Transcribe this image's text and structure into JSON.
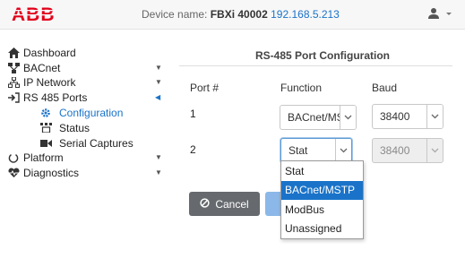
{
  "header": {
    "logo_text": "ABB",
    "device_label": "Device name:",
    "device_name": "FBXi 40002",
    "device_ip": "192.168.5.213",
    "brand_color": "#e2001a"
  },
  "sidebar": {
    "items": [
      {
        "label": "Dashboard",
        "icon": "home-icon"
      },
      {
        "label": "BACnet",
        "icon": "network-icon"
      },
      {
        "label": "IP Network",
        "icon": "sitemap-icon"
      },
      {
        "label": "RS 485 Ports",
        "icon": "sign-in-icon"
      },
      {
        "label": "Configuration",
        "icon": "gear-icon"
      },
      {
        "label": "Status",
        "icon": "status-icon"
      },
      {
        "label": "Serial Captures",
        "icon": "video-icon"
      },
      {
        "label": "Platform",
        "icon": "power-icon"
      },
      {
        "label": "Diagnostics",
        "icon": "heartbeat-icon"
      }
    ]
  },
  "panel": {
    "title": "RS-485 Port Configuration",
    "col_port": "Port #",
    "col_function": "Function",
    "col_baud": "Baud",
    "rows": [
      {
        "port": "1",
        "function": "BACnet/MSTP",
        "baud": "38400"
      },
      {
        "port": "2",
        "function": "Stat",
        "baud": "38400"
      }
    ],
    "dropdown_options": [
      "Stat",
      "BACnet/MSTP",
      "ModBus",
      "Unassigned"
    ],
    "highlighted_option": "BACnet/MSTP",
    "cancel_label": "Cancel"
  }
}
